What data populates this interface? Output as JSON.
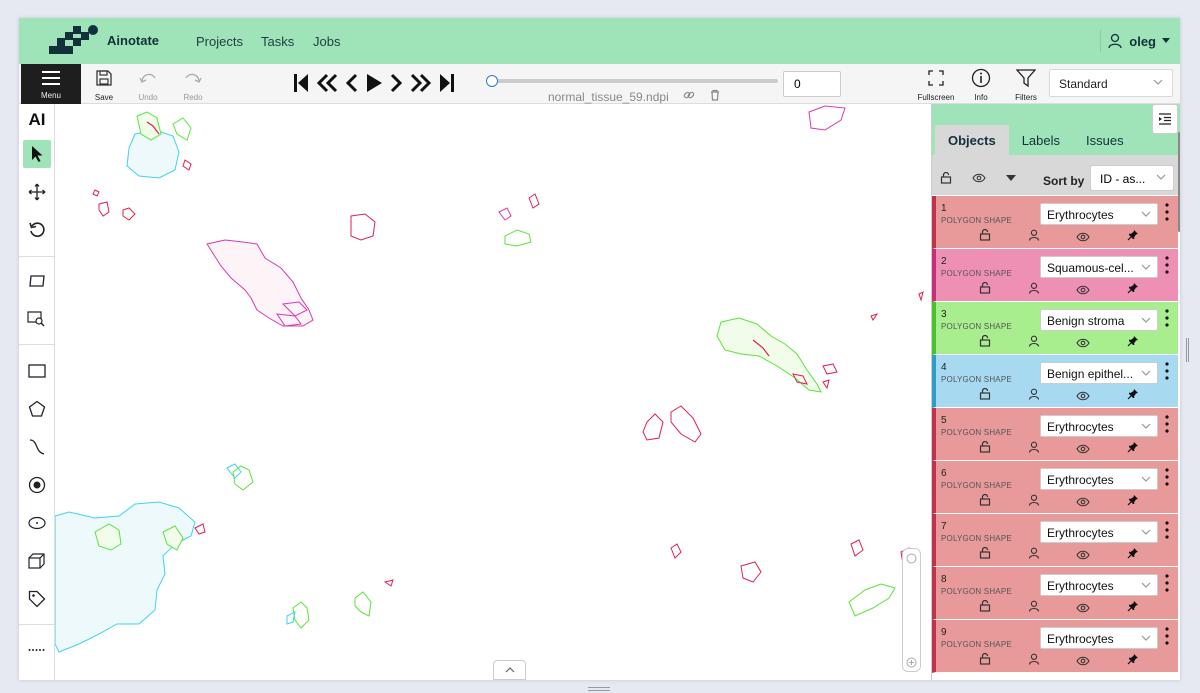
{
  "app": {
    "brand": "Ainotate"
  },
  "nav": {
    "projects": "Projects",
    "tasks": "Tasks",
    "jobs": "Jobs"
  },
  "user": {
    "name": "oleg"
  },
  "toolbar": {
    "menu": "Menu",
    "save": "Save",
    "undo": "Undo",
    "redo": "Redo",
    "frame": "0",
    "filename": "normal_tissue_59.ndpi",
    "fullscreen": "Fullscreen",
    "info": "Info",
    "filters": "Filters",
    "view_mode": "Standard"
  },
  "lefttools": {
    "ai": "AI"
  },
  "panel": {
    "tabs": [
      "Objects",
      "Labels",
      "Issues"
    ],
    "sort_label": "Sort by",
    "sort_value": "ID - as...",
    "objects": [
      {
        "id": "1",
        "type": "POLYGON SHAPE",
        "label": "Erythrocytes",
        "color": "#e89a9a",
        "border": "#c0314a"
      },
      {
        "id": "2",
        "type": "POLYGON SHAPE",
        "label": "Squamous-cel...",
        "color": "#ee8fb4",
        "border": "#c72f7a"
      },
      {
        "id": "3",
        "type": "POLYGON SHAPE",
        "label": "Benign stroma",
        "color": "#a8ee8f",
        "border": "#4cc02f"
      },
      {
        "id": "4",
        "type": "POLYGON SHAPE",
        "label": "Benign epithel...",
        "color": "#a7daf0",
        "border": "#2f9ec7"
      },
      {
        "id": "5",
        "type": "POLYGON SHAPE",
        "label": "Erythrocytes",
        "color": "#e89a9a",
        "border": "#c0314a"
      },
      {
        "id": "6",
        "type": "POLYGON SHAPE",
        "label": "Erythrocytes",
        "color": "#e89a9a",
        "border": "#c0314a"
      },
      {
        "id": "7",
        "type": "POLYGON SHAPE",
        "label": "Erythrocytes",
        "color": "#e89a9a",
        "border": "#c0314a"
      },
      {
        "id": "8",
        "type": "POLYGON SHAPE",
        "label": "Erythrocytes",
        "color": "#e89a9a",
        "border": "#c0314a"
      },
      {
        "id": "9",
        "type": "POLYGON SHAPE",
        "label": "Erythrocytes",
        "color": "#e89a9a",
        "border": "#c0314a"
      }
    ]
  },
  "colors": {
    "header": "#9fe3b9",
    "accent_red": "#e0204f",
    "accent_magenta": "#d63bb0",
    "accent_green": "#5be33a",
    "accent_cyan": "#3fd4e8"
  },
  "icons": [
    "menu-icon",
    "save-icon",
    "undo-icon",
    "redo-icon",
    "fullscreen-icon",
    "info-icon",
    "filter-icon",
    "user-icon",
    "lock-icon",
    "eye-icon",
    "pin-icon"
  ]
}
